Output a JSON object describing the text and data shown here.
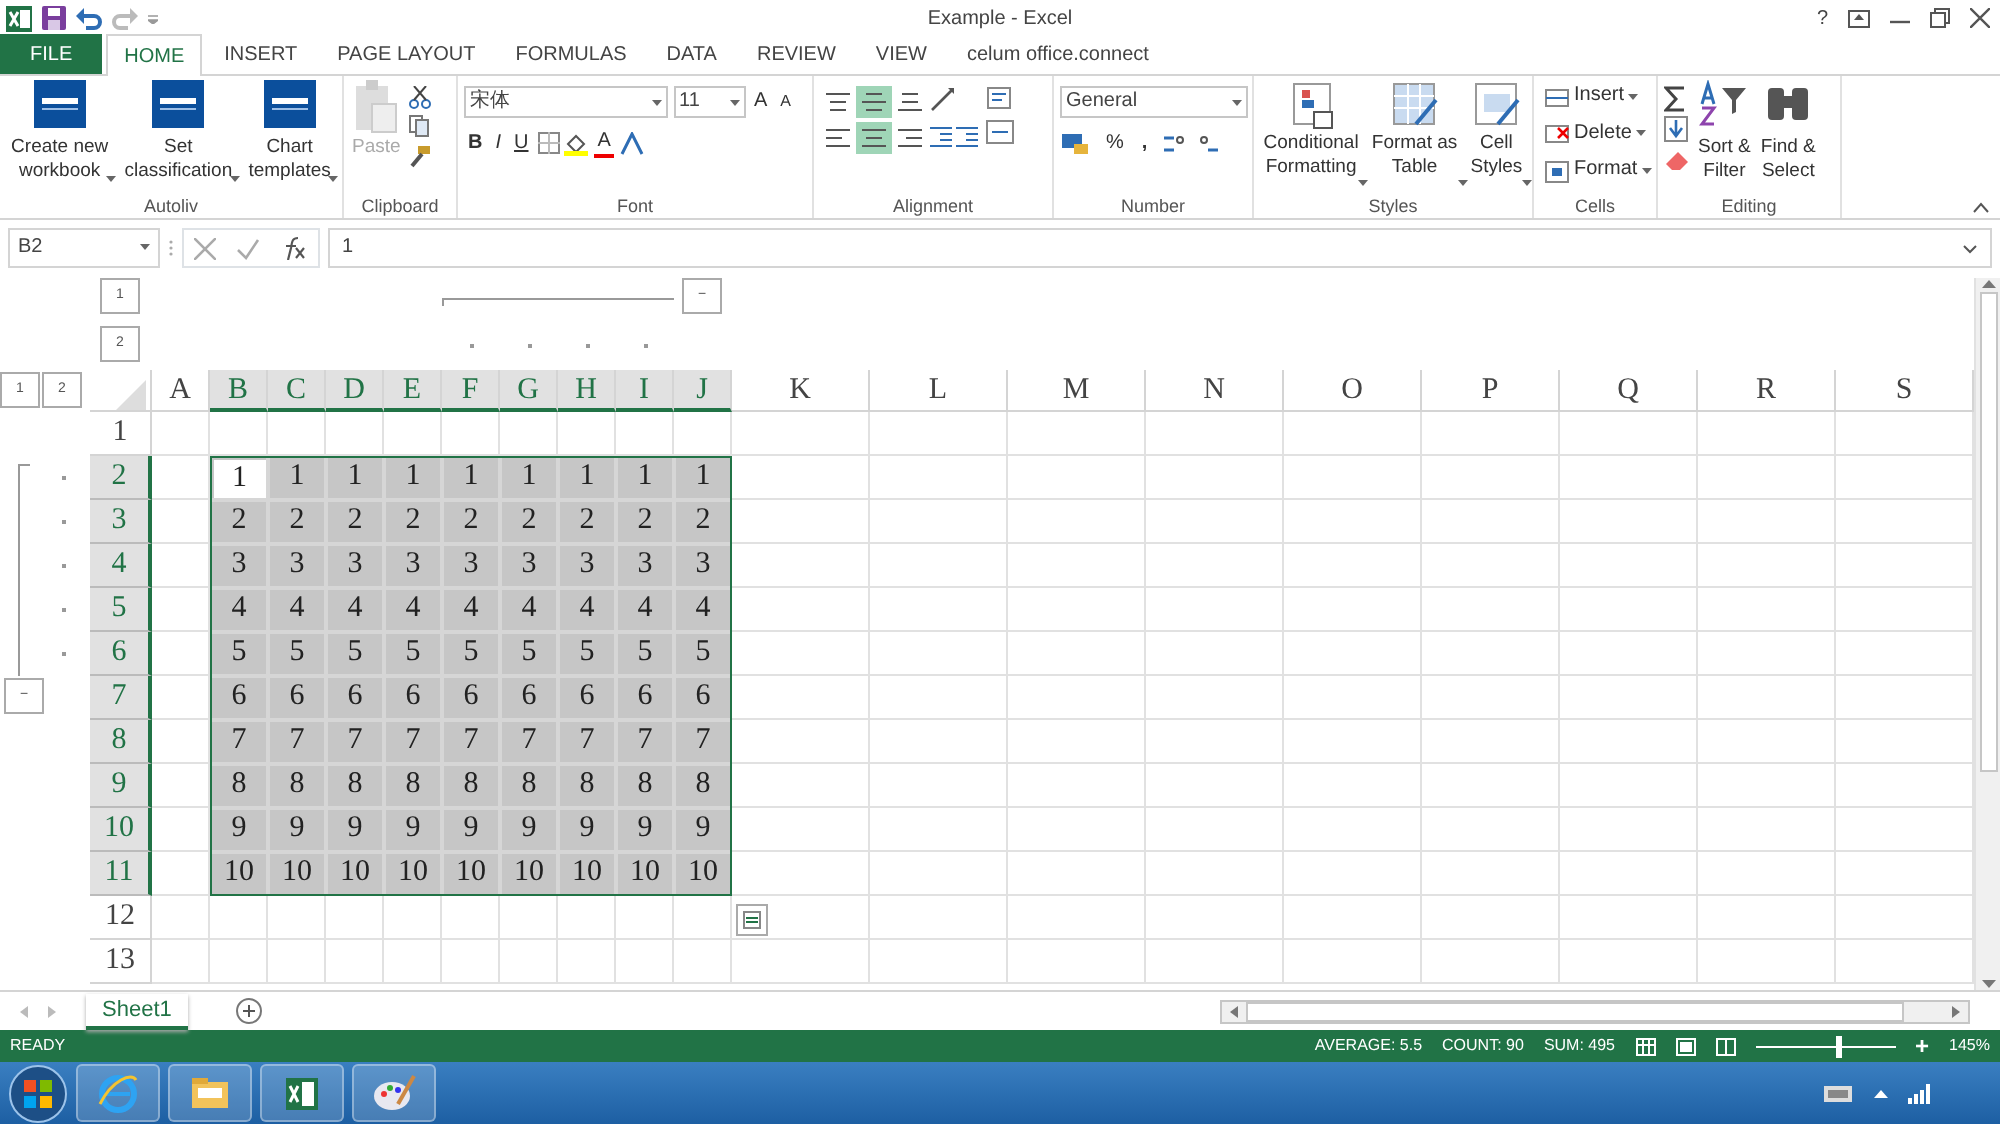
{
  "window": {
    "title": "Example - Excel",
    "help": "?"
  },
  "tabs": [
    {
      "label": "FILE",
      "kind": "file",
      "selected": false
    },
    {
      "label": "HOME",
      "kind": "tab",
      "selected": true
    },
    {
      "label": "INSERT",
      "kind": "tab",
      "selected": false
    },
    {
      "label": "PAGE LAYOUT",
      "kind": "tab",
      "selected": false
    },
    {
      "label": "FORMULAS",
      "kind": "tab",
      "selected": false
    },
    {
      "label": "DATA",
      "kind": "tab",
      "selected": false
    },
    {
      "label": "REVIEW",
      "kind": "tab",
      "selected": false
    },
    {
      "label": "VIEW",
      "kind": "tab",
      "selected": false
    },
    {
      "label": "celum office.connect",
      "kind": "tab",
      "selected": false
    }
  ],
  "ribbon": {
    "groups": [
      {
        "label": "Autoliv",
        "kind": "addin",
        "buttons": [
          {
            "lines": [
              "Create new",
              "workbook"
            ]
          },
          {
            "lines": [
              "Set",
              "classification"
            ]
          },
          {
            "lines": [
              "Chart",
              "templates"
            ]
          }
        ]
      },
      {
        "label": "Clipboard",
        "kind": "clipboard",
        "paste": {
          "label": "Paste",
          "disabled": true
        }
      },
      {
        "label": "Font",
        "kind": "font",
        "font_name": "宋体",
        "font_size": "11",
        "grow": "A",
        "shrink": "A",
        "styles": [
          "B",
          "I",
          "U"
        ],
        "font_color": "A"
      },
      {
        "label": "Alignment",
        "kind": "alignment",
        "buttons": [
          {
            "selected": false
          },
          {
            "selected": true
          },
          {
            "selected": false
          },
          {
            "selected": false
          },
          {
            "selected": true
          },
          {
            "selected": false
          }
        ]
      },
      {
        "label": "Number",
        "kind": "number",
        "format": "General",
        "percent": "%",
        "comma": ","
      },
      {
        "label": "Styles",
        "kind": "styles",
        "buttons": [
          {
            "lines": [
              "Conditional",
              "Formatting"
            ]
          },
          {
            "lines": [
              "Format as",
              "Table"
            ]
          },
          {
            "lines": [
              "Cell",
              "Styles"
            ]
          }
        ]
      },
      {
        "label": "Cells",
        "kind": "cells",
        "buttons": [
          "Insert",
          "Delete",
          "Format"
        ]
      },
      {
        "label": "Editing",
        "kind": "editing",
        "buttons": [
          {
            "lines": [
              "Sort &",
              "Filter"
            ]
          },
          {
            "lines": [
              "Find &",
              "Select"
            ]
          }
        ]
      }
    ]
  },
  "formula_bar": {
    "name_box": "B2",
    "formula": "1"
  },
  "outline": {
    "column_levels": [
      "1",
      "2"
    ],
    "row_levels": [
      "1",
      "2"
    ],
    "column_collapse": "−",
    "row_collapse": "−"
  },
  "columns": [
    {
      "label": "A",
      "selected": false
    },
    {
      "label": "B",
      "selected": true
    },
    {
      "label": "C",
      "selected": true
    },
    {
      "label": "D",
      "selected": true
    },
    {
      "label": "E",
      "selected": true
    },
    {
      "label": "F",
      "selected": true
    },
    {
      "label": "G",
      "selected": true
    },
    {
      "label": "H",
      "selected": true
    },
    {
      "label": "I",
      "selected": true
    },
    {
      "label": "J",
      "selected": true
    },
    {
      "label": "K",
      "selected": false
    },
    {
      "label": "L",
      "selected": false
    },
    {
      "label": "M",
      "selected": false
    },
    {
      "label": "N",
      "selected": false
    },
    {
      "label": "O",
      "selected": false
    },
    {
      "label": "P",
      "selected": false
    },
    {
      "label": "Q",
      "selected": false
    },
    {
      "label": "R",
      "selected": false
    },
    {
      "label": "S",
      "selected": false
    }
  ],
  "rows": [
    {
      "label": "1",
      "selected": false
    },
    {
      "label": "2",
      "selected": true,
      "cells": [
        {
          "value": "1",
          "active": true
        },
        {
          "value": "1",
          "active": false
        },
        {
          "value": "1",
          "active": false
        },
        {
          "value": "1",
          "active": false
        },
        {
          "value": "1",
          "active": false
        },
        {
          "value": "1",
          "active": false
        },
        {
          "value": "1",
          "active": false
        },
        {
          "value": "1",
          "active": false
        },
        {
          "value": "1",
          "active": false
        }
      ]
    },
    {
      "label": "3",
      "selected": true,
      "cells": [
        {
          "value": "2",
          "active": false
        },
        {
          "value": "2",
          "active": false
        },
        {
          "value": "2",
          "active": false
        },
        {
          "value": "2",
          "active": false
        },
        {
          "value": "2",
          "active": false
        },
        {
          "value": "2",
          "active": false
        },
        {
          "value": "2",
          "active": false
        },
        {
          "value": "2",
          "active": false
        },
        {
          "value": "2",
          "active": false
        }
      ]
    },
    {
      "label": "4",
      "selected": true,
      "cells": [
        {
          "value": "3",
          "active": false
        },
        {
          "value": "3",
          "active": false
        },
        {
          "value": "3",
          "active": false
        },
        {
          "value": "3",
          "active": false
        },
        {
          "value": "3",
          "active": false
        },
        {
          "value": "3",
          "active": false
        },
        {
          "value": "3",
          "active": false
        },
        {
          "value": "3",
          "active": false
        },
        {
          "value": "3",
          "active": false
        }
      ]
    },
    {
      "label": "5",
      "selected": true,
      "cells": [
        {
          "value": "4",
          "active": false
        },
        {
          "value": "4",
          "active": false
        },
        {
          "value": "4",
          "active": false
        },
        {
          "value": "4",
          "active": false
        },
        {
          "value": "4",
          "active": false
        },
        {
          "value": "4",
          "active": false
        },
        {
          "value": "4",
          "active": false
        },
        {
          "value": "4",
          "active": false
        },
        {
          "value": "4",
          "active": false
        }
      ]
    },
    {
      "label": "6",
      "selected": true,
      "cells": [
        {
          "value": "5",
          "active": false
        },
        {
          "value": "5",
          "active": false
        },
        {
          "value": "5",
          "active": false
        },
        {
          "value": "5",
          "active": false
        },
        {
          "value": "5",
          "active": false
        },
        {
          "value": "5",
          "active": false
        },
        {
          "value": "5",
          "active": false
        },
        {
          "value": "5",
          "active": false
        },
        {
          "value": "5",
          "active": false
        }
      ]
    },
    {
      "label": "7",
      "selected": true,
      "cells": [
        {
          "value": "6",
          "active": false
        },
        {
          "value": "6",
          "active": false
        },
        {
          "value": "6",
          "active": false
        },
        {
          "value": "6",
          "active": false
        },
        {
          "value": "6",
          "active": false
        },
        {
          "value": "6",
          "active": false
        },
        {
          "value": "6",
          "active": false
        },
        {
          "value": "6",
          "active": false
        },
        {
          "value": "6",
          "active": false
        }
      ]
    },
    {
      "label": "8",
      "selected": true,
      "cells": [
        {
          "value": "7",
          "active": false
        },
        {
          "value": "7",
          "active": false
        },
        {
          "value": "7",
          "active": false
        },
        {
          "value": "7",
          "active": false
        },
        {
          "value": "7",
          "active": false
        },
        {
          "value": "7",
          "active": false
        },
        {
          "value": "7",
          "active": false
        },
        {
          "value": "7",
          "active": false
        },
        {
          "value": "7",
          "active": false
        }
      ]
    },
    {
      "label": "9",
      "selected": true,
      "cells": [
        {
          "value": "8",
          "active": false
        },
        {
          "value": "8",
          "active": false
        },
        {
          "value": "8",
          "active": false
        },
        {
          "value": "8",
          "active": false
        },
        {
          "value": "8",
          "active": false
        },
        {
          "value": "8",
          "active": false
        },
        {
          "value": "8",
          "active": false
        },
        {
          "value": "8",
          "active": false
        },
        {
          "value": "8",
          "active": false
        }
      ]
    },
    {
      "label": "10",
      "selected": true,
      "cells": [
        {
          "value": "9",
          "active": false
        },
        {
          "value": "9",
          "active": false
        },
        {
          "value": "9",
          "active": false
        },
        {
          "value": "9",
          "active": false
        },
        {
          "value": "9",
          "active": false
        },
        {
          "value": "9",
          "active": false
        },
        {
          "value": "9",
          "active": false
        },
        {
          "value": "9",
          "active": false
        },
        {
          "value": "9",
          "active": false
        }
      ]
    },
    {
      "label": "11",
      "selected": true,
      "cells": [
        {
          "value": "10",
          "active": false
        },
        {
          "value": "10",
          "active": false
        },
        {
          "value": "10",
          "active": false
        },
        {
          "value": "10",
          "active": false
        },
        {
          "value": "10",
          "active": false
        },
        {
          "value": "10",
          "active": false
        },
        {
          "value": "10",
          "active": false
        },
        {
          "value": "10",
          "active": false
        },
        {
          "value": "10",
          "active": false
        }
      ]
    },
    {
      "label": "12",
      "selected": false
    },
    {
      "label": "13",
      "selected": false
    }
  ],
  "sheets": [
    {
      "label": "Sheet1",
      "selected": true
    }
  ],
  "status_bar": {
    "mode": "READY",
    "stats": [
      "AVERAGE: 5.5",
      "COUNT: 90",
      "SUM: 495"
    ],
    "zoom_in": "+",
    "zoom_slider": {
      "level": 0.58
    },
    "zoom": "145%"
  }
}
